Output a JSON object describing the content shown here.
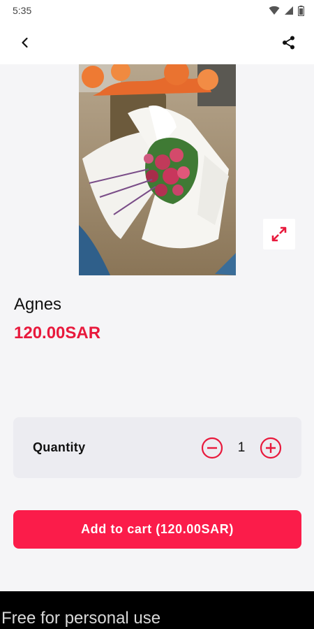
{
  "status_bar": {
    "time": "5:35"
  },
  "product": {
    "name": "Agnes",
    "price": "120.00SAR"
  },
  "quantity": {
    "label": "Quantity",
    "value": "1"
  },
  "add_to_cart": {
    "label": "Add to cart (120.00SAR)"
  },
  "footer": {
    "text": "Free for personal use"
  },
  "colors": {
    "accent": "#e8193c",
    "button": "#fb1c4a",
    "card": "#ececf1",
    "background": "#f5f5f7"
  },
  "icons": [
    "back-arrow-icon",
    "share-icon",
    "expand-icon",
    "minus-icon",
    "plus-icon",
    "wifi-icon",
    "signal-icon",
    "battery-icon"
  ]
}
